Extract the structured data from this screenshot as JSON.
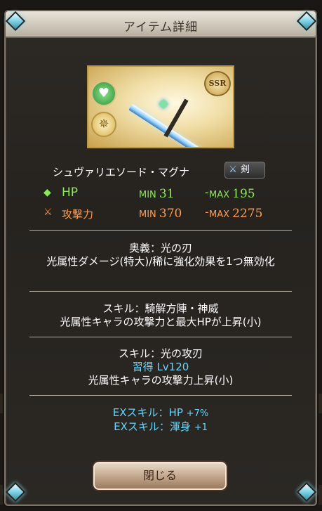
{
  "header": {
    "title": "アイテム詳細"
  },
  "weapon": {
    "rarity": "SSR",
    "element_icon": "heart-icon",
    "type_icon": "compass-icon",
    "name": "シュヴァリエソード・マグナ",
    "type_label": "剣"
  },
  "stats": {
    "hp": {
      "label": "HP",
      "min_label": "MIN",
      "min": "31",
      "max_label": "MAX",
      "max": "195"
    },
    "atk": {
      "label": "攻撃力",
      "min_label": "MIN",
      "min": "370",
      "max_label": "MAX",
      "max": "2275"
    },
    "dash": "-"
  },
  "ougi": {
    "title": "奥義：光の刃",
    "desc": "光属性ダメージ(特大)/稀に強化効果を1つ無効化"
  },
  "skill1": {
    "title": "スキル：騎解方陣・神威",
    "desc": "光属性キャラの攻撃力と最大HPが上昇(小)"
  },
  "skill2": {
    "title": "スキル：光の攻刃",
    "unlock": "習得 Lv120",
    "desc": "光属性キャラの攻撃力上昇(小)"
  },
  "ex_skills": [
    {
      "label": "EXスキル：HP",
      "value": "+7%"
    },
    {
      "label": "EXスキル：渾身",
      "value": "+1"
    }
  ],
  "buttons": {
    "close": "閉じる"
  },
  "colors": {
    "hp": "#8ce85a",
    "atk": "#ff9a52",
    "ex": "#63d6ff"
  }
}
